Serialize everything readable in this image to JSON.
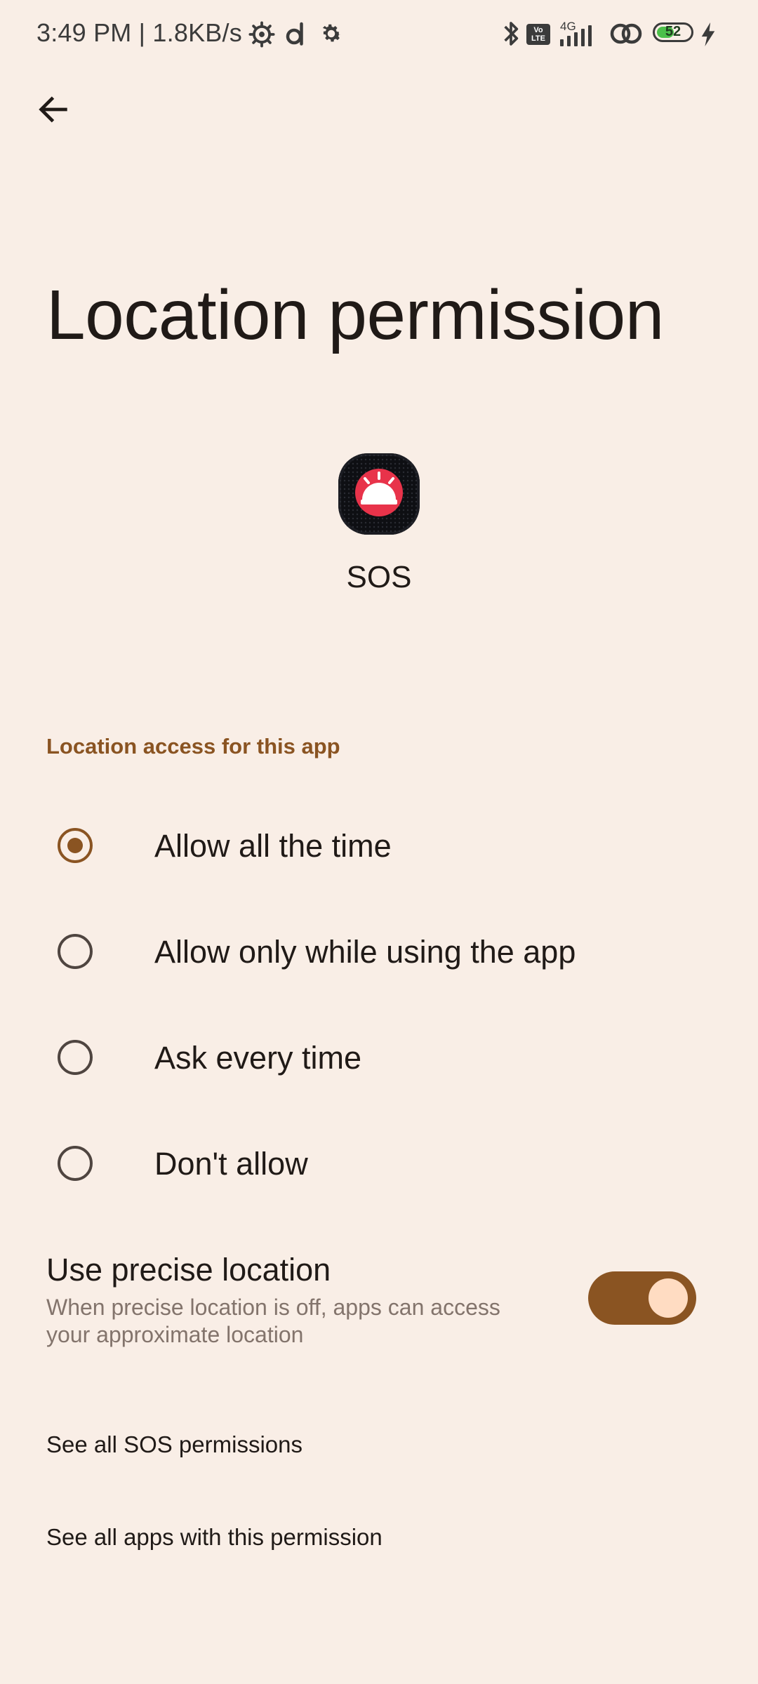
{
  "status_bar": {
    "time": "3:49 PM | 1.8KB/s",
    "network_type": "4G",
    "volte_label": "Vo LTE",
    "battery_level": "52",
    "battery_fraction": 0.52,
    "icons": [
      "settings-gear-icon",
      "d-app-icon",
      "gear-icon",
      "bluetooth-icon",
      "volte-icon",
      "signal-icon",
      "link-icon",
      "battery-icon",
      "charging-bolt-icon"
    ]
  },
  "header": {
    "back_icon": "arrow-left-icon",
    "title": "Location permission"
  },
  "app": {
    "name": "SOS",
    "icon": "siren-icon"
  },
  "section": {
    "header": "Location access for this app"
  },
  "options": [
    {
      "label": "Allow all the time",
      "selected": true
    },
    {
      "label": "Allow only while using the app",
      "selected": false
    },
    {
      "label": "Ask every time",
      "selected": false
    },
    {
      "label": "Don't allow",
      "selected": false
    }
  ],
  "precise": {
    "title": "Use precise location",
    "description": "When precise location is off, apps can access your approximate location",
    "enabled": true
  },
  "links": {
    "see_all_app_permissions": "See all SOS permissions",
    "see_all_apps_with_permission": "See all apps with this permission"
  },
  "colors": {
    "background": "#f9eee6",
    "accent": "#8a5422",
    "toggle_thumb": "#ffdcc2",
    "text_primary": "#201a17",
    "text_secondary": "#83746c"
  }
}
